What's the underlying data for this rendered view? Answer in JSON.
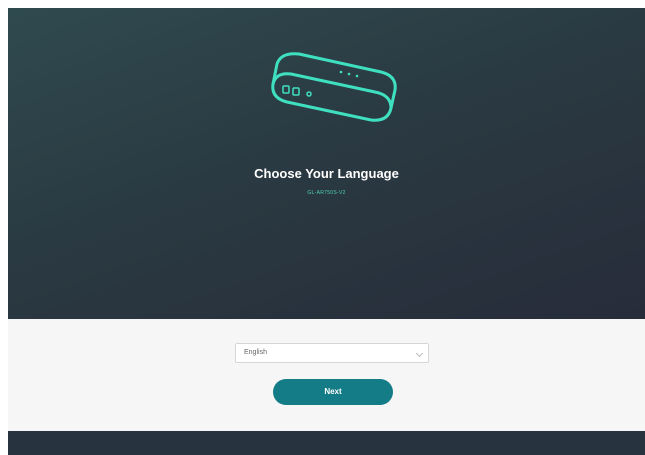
{
  "header": {
    "title": "Choose Your Language",
    "subtitle": "GL-AR750S-V2",
    "icon": "router-icon"
  },
  "language_select": {
    "value": "English"
  },
  "next_button": {
    "label": "Next"
  },
  "colors": {
    "accent": "#4fd1b6",
    "button": "#137c87",
    "hero_dark": "#272c3a",
    "hero_teal": "#2f4a4f"
  }
}
